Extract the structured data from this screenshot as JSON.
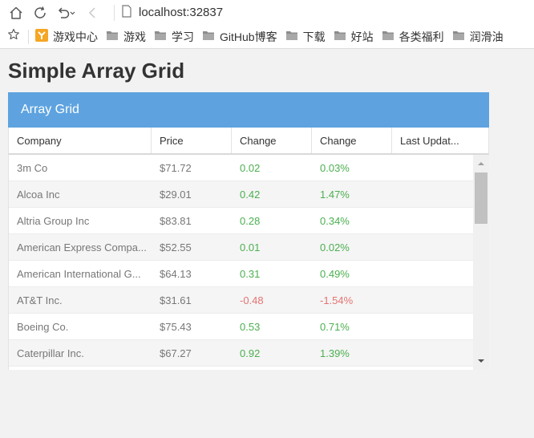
{
  "browser": {
    "url": "localhost:32837",
    "bookmarks": [
      {
        "label": "游戏中心",
        "icon": "game-center-icon"
      },
      {
        "label": "游戏",
        "icon": "folder-icon"
      },
      {
        "label": "学习",
        "icon": "folder-icon"
      },
      {
        "label": "GitHub博客",
        "icon": "folder-icon"
      },
      {
        "label": "下载",
        "icon": "folder-icon"
      },
      {
        "label": "好站",
        "icon": "folder-icon"
      },
      {
        "label": "各类福利",
        "icon": "folder-icon"
      },
      {
        "label": "润滑油",
        "icon": "folder-icon"
      }
    ]
  },
  "page": {
    "title": "Simple Array Grid"
  },
  "grid": {
    "title": "Array Grid",
    "columns": [
      "Company",
      "Price",
      "Change",
      "Change",
      "Last Updat..."
    ],
    "rows": [
      {
        "company": "3m Co",
        "price": "$71.72",
        "change": "0.02",
        "pct": "0.03%",
        "dir": "pos"
      },
      {
        "company": "Alcoa Inc",
        "price": "$29.01",
        "change": "0.42",
        "pct": "1.47%",
        "dir": "pos"
      },
      {
        "company": "Altria Group Inc",
        "price": "$83.81",
        "change": "0.28",
        "pct": "0.34%",
        "dir": "pos"
      },
      {
        "company": "American Express Compa...",
        "price": "$52.55",
        "change": "0.01",
        "pct": "0.02%",
        "dir": "pos"
      },
      {
        "company": "American International G...",
        "price": "$64.13",
        "change": "0.31",
        "pct": "0.49%",
        "dir": "pos"
      },
      {
        "company": "AT&T Inc.",
        "price": "$31.61",
        "change": "-0.48",
        "pct": "-1.54%",
        "dir": "neg"
      },
      {
        "company": "Boeing Co.",
        "price": "$75.43",
        "change": "0.53",
        "pct": "0.71%",
        "dir": "pos"
      },
      {
        "company": "Caterpillar Inc.",
        "price": "$67.27",
        "change": "0.92",
        "pct": "1.39%",
        "dir": "pos"
      },
      {
        "company": "",
        "price": "",
        "change": "",
        "pct": "",
        "dir": "pos"
      }
    ]
  },
  "colors": {
    "header_bg": "#5ea3e0",
    "positive": "#4caf50",
    "negative": "#e57373"
  }
}
